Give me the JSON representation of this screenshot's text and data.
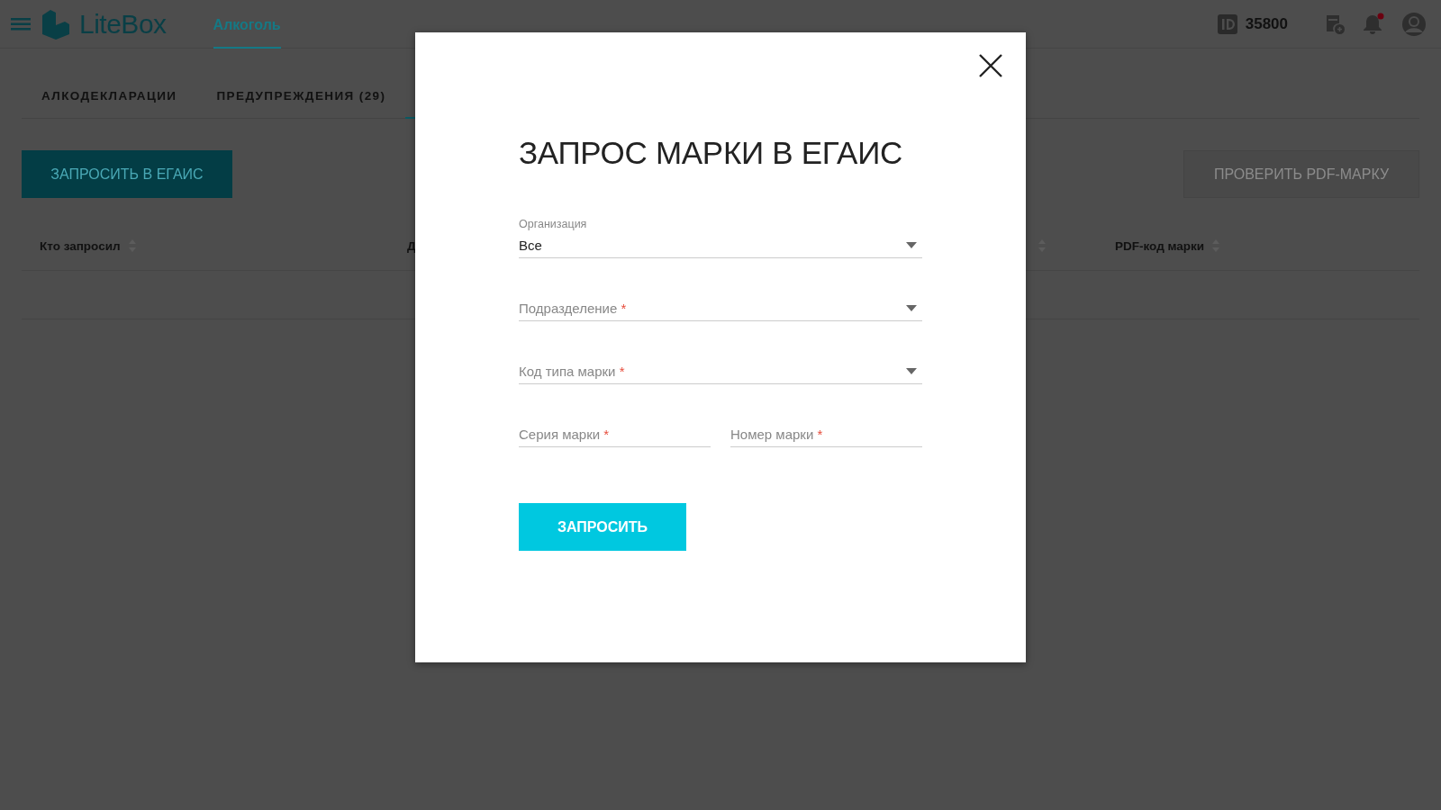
{
  "header": {
    "brand": "LiteBox",
    "nav": [
      {
        "label": "Алкоголь",
        "selected": true
      }
    ],
    "account_id": "35800",
    "notifications_unread": true
  },
  "tabs": [
    {
      "label": "АЛКОДЕКЛАРАЦИИ",
      "selected": false
    },
    {
      "label": "ПРЕДУПРЕЖДЕНИЯ (29)",
      "selected": false
    },
    {
      "selected": true
    }
  ],
  "actions": {
    "primary": "ЗАПРОСИТЬ В ЕГАИС",
    "secondary": "ПРОВЕРИТЬ PDF-МАРКУ"
  },
  "table": {
    "columns": [
      {
        "label": "Кто запросил",
        "sortable": true
      },
      {
        "label": "Д",
        "sortable": false
      },
      {
        "sortable": true
      },
      {
        "label": "PDF-код марки",
        "sortable": true
      }
    ]
  },
  "dialog": {
    "title": "ЗАПРОС МАРКИ В ЕГАИС",
    "fields": [
      {
        "kind": "select",
        "label": "Организация",
        "value": "Все"
      },
      {
        "kind": "select",
        "placeholder": "Подразделение",
        "required_mark": "*"
      },
      {
        "kind": "select",
        "placeholder": "Код типа марки",
        "required_mark": "*"
      }
    ],
    "pair_fields": [
      {
        "kind": "text",
        "placeholder": "Серия марки",
        "required_mark": "*"
      },
      {
        "kind": "text",
        "placeholder": "Номер марки",
        "required_mark": "*"
      }
    ],
    "submit": "ЗАПРОСИТЬ"
  }
}
